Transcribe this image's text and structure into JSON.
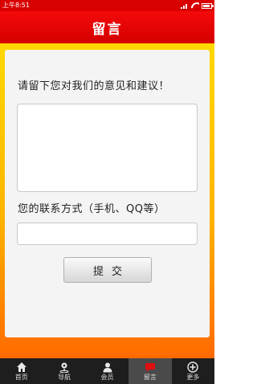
{
  "status_bar": {
    "time": "上午8:51"
  },
  "header": {
    "title": "留言"
  },
  "form": {
    "prompt_label": "请留下您对我们的意见和建议！",
    "message_value": "",
    "contact_label": "您的联系方式（手机、QQ等）",
    "contact_value": "",
    "submit_label": "提交"
  },
  "bottom_nav": {
    "items": [
      {
        "label": "首页",
        "icon": "home-icon"
      },
      {
        "label": "导航",
        "icon": "navigation-icon"
      },
      {
        "label": "会员",
        "icon": "member-icon"
      },
      {
        "label": "留言",
        "icon": "message-icon",
        "active": true
      },
      {
        "label": "更多",
        "icon": "more-icon"
      }
    ]
  },
  "colors": {
    "header_red": "#e00000",
    "border_yellow": "#ffd800",
    "border_orange": "#ff6a00",
    "nav_dark": "#1e1e1e",
    "active_icon_red": "#e01010"
  }
}
